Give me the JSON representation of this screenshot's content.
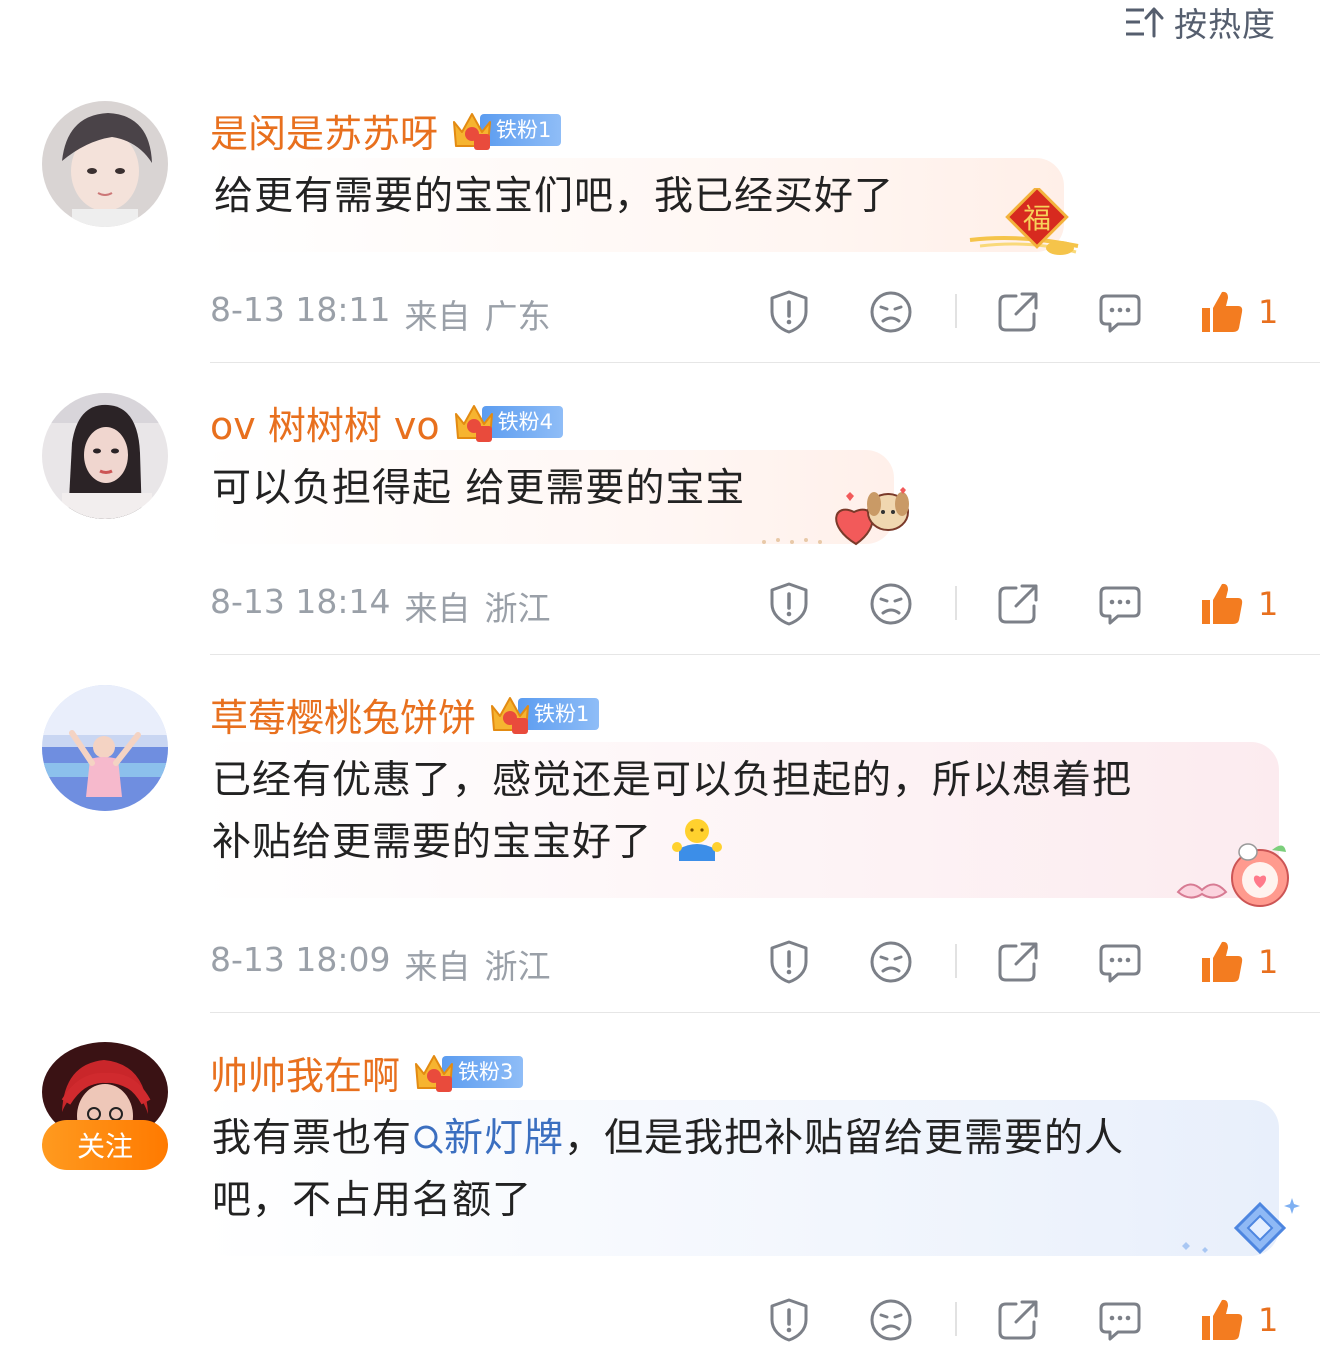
{
  "sort": {
    "label": "按热度",
    "icon": "sort-icon"
  },
  "comments": [
    {
      "username": "是闵是苏苏呀",
      "fan_level": "铁粉1",
      "text": "给更有需要的宝宝们吧，我已经买好了",
      "date": "8-13 18:11",
      "from": "来自",
      "location": "广东",
      "likes": "1",
      "sticker": "福"
    },
    {
      "username": "ov 树树树 vo",
      "fan_level": "铁粉4",
      "text": "可以负担得起 给更需要的宝宝",
      "date": "8-13 18:14",
      "from": "来自",
      "location": "浙江",
      "likes": "1"
    },
    {
      "username": "草莓樱桃兔饼饼",
      "fan_level": "铁粉1",
      "text_line1": "已经有优惠了，感觉还是可以负担起的，所以想着把",
      "text_line2": "补贴给更需要的宝宝好了",
      "date": "8-13 18:09",
      "from": "来自",
      "location": "浙江",
      "likes": "1"
    },
    {
      "username": "帅帅我在啊",
      "fan_level": "铁粉3",
      "follow_label": "关注",
      "text_prefix": "我有票也有",
      "topic": "新灯牌",
      "text_suffix": "，但是我把补贴留给更需要的人",
      "text_line2": "吧，不占用名额了",
      "likes": "1"
    }
  ],
  "colors": {
    "accent": "#e8701e",
    "link": "#3b6fc0",
    "meta": "#9aa0a8",
    "fan_badge": "#5b9cf0"
  }
}
